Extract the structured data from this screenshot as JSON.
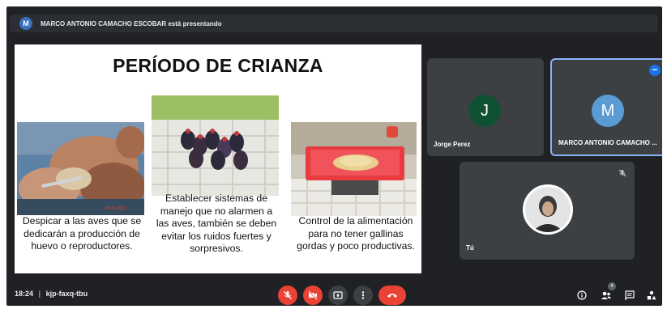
{
  "banner": {
    "avatar_letter": "M",
    "text": "MARCO ANTONIO CAMACHO ESCOBAR está presentando"
  },
  "slide": {
    "title": "PERÍODO DE CRIANZA",
    "captions": [
      "Despicar a las aves que se dedicarán a producción de huevo o reproductores.",
      "Establecer sistemas de manejo que no alarmen a las aves, también se deben evitar los ruidos fuertes y sorpresivos.",
      "Control de la alimentación para no tener gallinas gordas y poco productivas."
    ],
    "photo_date": "26.06.2013"
  },
  "participants": [
    {
      "name": "Jorge Perez",
      "letter": "J",
      "color": "#0f5132"
    },
    {
      "name": "MARCO ANTONIO CAMACHO ...",
      "letter": "M",
      "color": "#5b9bd5",
      "badge": "•••"
    },
    {
      "name": "Tú"
    }
  ],
  "bottom_bar": {
    "time": "18:24",
    "meeting_code": "kjp-faxq-tbu",
    "people_count": "4"
  },
  "colors": {
    "background": "#202124",
    "tile": "#3c4043",
    "danger": "#ea4335",
    "accent": "#8ab4f8"
  },
  "icons": [
    "mic-off-icon",
    "camera-off-icon",
    "present-icon",
    "more-icon",
    "hangup-icon",
    "info-icon",
    "people-icon",
    "chat-icon",
    "activities-icon",
    "pin-icon",
    "muted-icon"
  ]
}
